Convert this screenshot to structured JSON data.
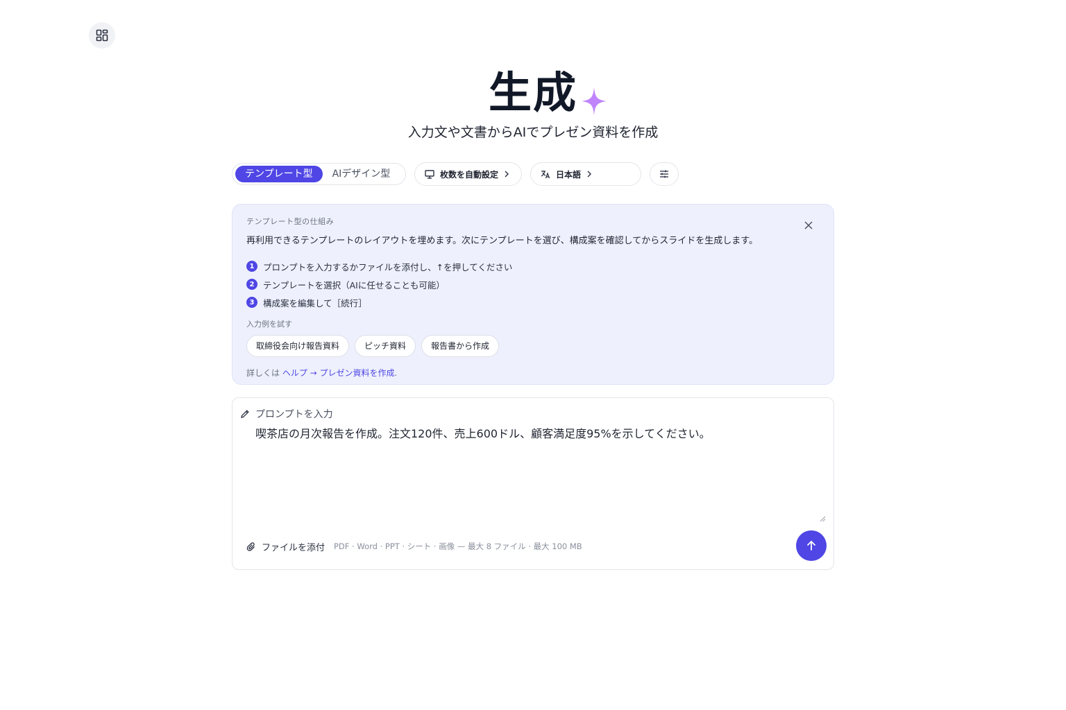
{
  "header": {
    "title": "生成",
    "subtitle": "入力文や文書からAIでプレゼン資料を作成"
  },
  "toolbar": {
    "mode_template": "テンプレート型",
    "mode_ai": "AIデザイン型",
    "slides_label": "枚数を自動設定",
    "language_label": "日本語"
  },
  "info": {
    "caption": "テンプレート型の仕組み",
    "description": "再利用できるテンプレートのレイアウトを埋めます。次にテンプレートを選び、構成案を確認してからスライドを生成します。",
    "steps": [
      {
        "num": "1",
        "text": "プロンプトを入力するかファイルを添付し、↑を押してください"
      },
      {
        "num": "2",
        "text": "テンプレートを選択（AIに任せることも可能）"
      },
      {
        "num": "3",
        "text": "構成案を編集して［続行］"
      }
    ],
    "try_label": "入力例を試す",
    "examples": [
      "取締役会向け報告資料",
      "ピッチ資料",
      "報告書から作成"
    ],
    "more_prefix": "詳しくは",
    "more_link": "ヘルプ → プレゼン資料を作成",
    "more_suffix": "."
  },
  "prompt": {
    "label": "プロンプトを入力",
    "value": "喫茶店の月次報告を作成。注文120件、売上600ドル、顧客満足度95%を示してください。",
    "attach_label": "ファイルを添付",
    "hint": "PDF · Word · PPT · シート · 画像 — 最大 8 ファイル · 最大 100 MB"
  },
  "colors": {
    "accent": "#4f46e5",
    "sparkle": "#c084fc",
    "info_bg": "#eef1fd"
  }
}
